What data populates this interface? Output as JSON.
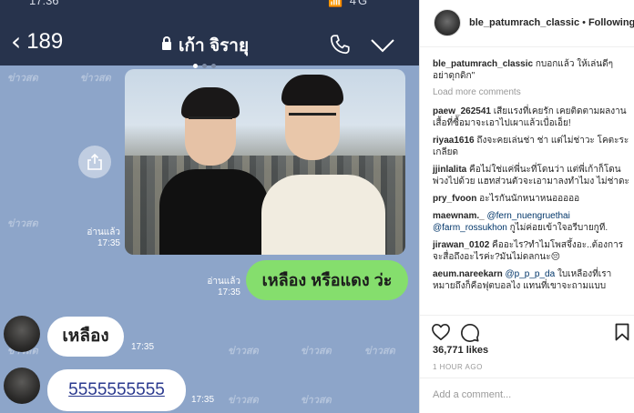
{
  "chat": {
    "status_time": "17:36",
    "status_signal": "📶 4G",
    "back_count": "189",
    "title": "เก้า จิรายุ",
    "watermark": "ข่าวสด",
    "photo_read_label": "อ่านแล้ว",
    "photo_time": "17:35",
    "green_read_label": "อ่านแล้ว",
    "green_time": "17:35",
    "green_text": "เหลือง หรือแดง ว่ะ",
    "reply1_text": "เหลือง",
    "reply1_time": "17:35",
    "reply2_text": "5555555555",
    "reply2_time": "17:35",
    "colors": {
      "header": "#27334c",
      "background": "#8da5c9",
      "green_bubble": "#85de6d"
    },
    "icons": [
      "back-chevron-icon",
      "lock-icon",
      "phone-icon",
      "chevron-down-icon",
      "share-icon"
    ]
  },
  "instagram": {
    "username": "ble_patumrach_classic",
    "follow_label": "Following",
    "caption_user": "ble_patumrach_classic",
    "caption_text": "กบอกแล้ว ให้เล่นดีๆ อย่าดุกดิก\"",
    "load_more": "Load more comments",
    "comments": [
      {
        "user": "paew_262541",
        "text": "เสียแรงที่เคยรัก เคยติดตามผลงาน เสื้อที่ซื้อมาจะเอาไปเผาแล้วเบื่อเอ็ย!"
      },
      {
        "user": "riyaa1616",
        "text": "ถึงจะคยเล่นช่า ช่า แต่ไม่ช่าวะ โคตะระเกลียด"
      },
      {
        "user": "jjinlalita",
        "text": "คือไม่ใช่แค่พี่นะที่โดนว่า แต่พี่เก้าก็โดนพ่วงไปด้วย แฮทส่วนตัวจะเอามาลงทำไมง ไม่ช่าดะ"
      },
      {
        "user": "pry_fvoon",
        "text": "อะไรกันนักหนาหนอออออ"
      },
      {
        "user": "maewnam._",
        "mention1": "@fern_nuengruethai",
        "mention2": "@farm_rossukhon",
        "text": "กูไม่ค่อยเข้าใจอรีบายกูที."
      },
      {
        "user": "jirawan_0102",
        "text": "คืออะไร?ทำไมโพสจึ้งอะ..ต้องการจะสื่อถึงอะไรค่ะ?มันไม่ดลกนะ😔"
      },
      {
        "user": "aeum.nareekarn",
        "mention1": "@p_p_p_da",
        "text": "ใบเหลืองที่เราหมายถึงก็คือฟุตบอลไง แทนที่เขาจะถามแบบ"
      }
    ],
    "likes": "36,771 likes",
    "time_ago": "1 HOUR AGO",
    "add_comment_placeholder": "Add a comment...",
    "icons": [
      "heart-icon",
      "comment-icon",
      "bookmark-icon"
    ]
  }
}
